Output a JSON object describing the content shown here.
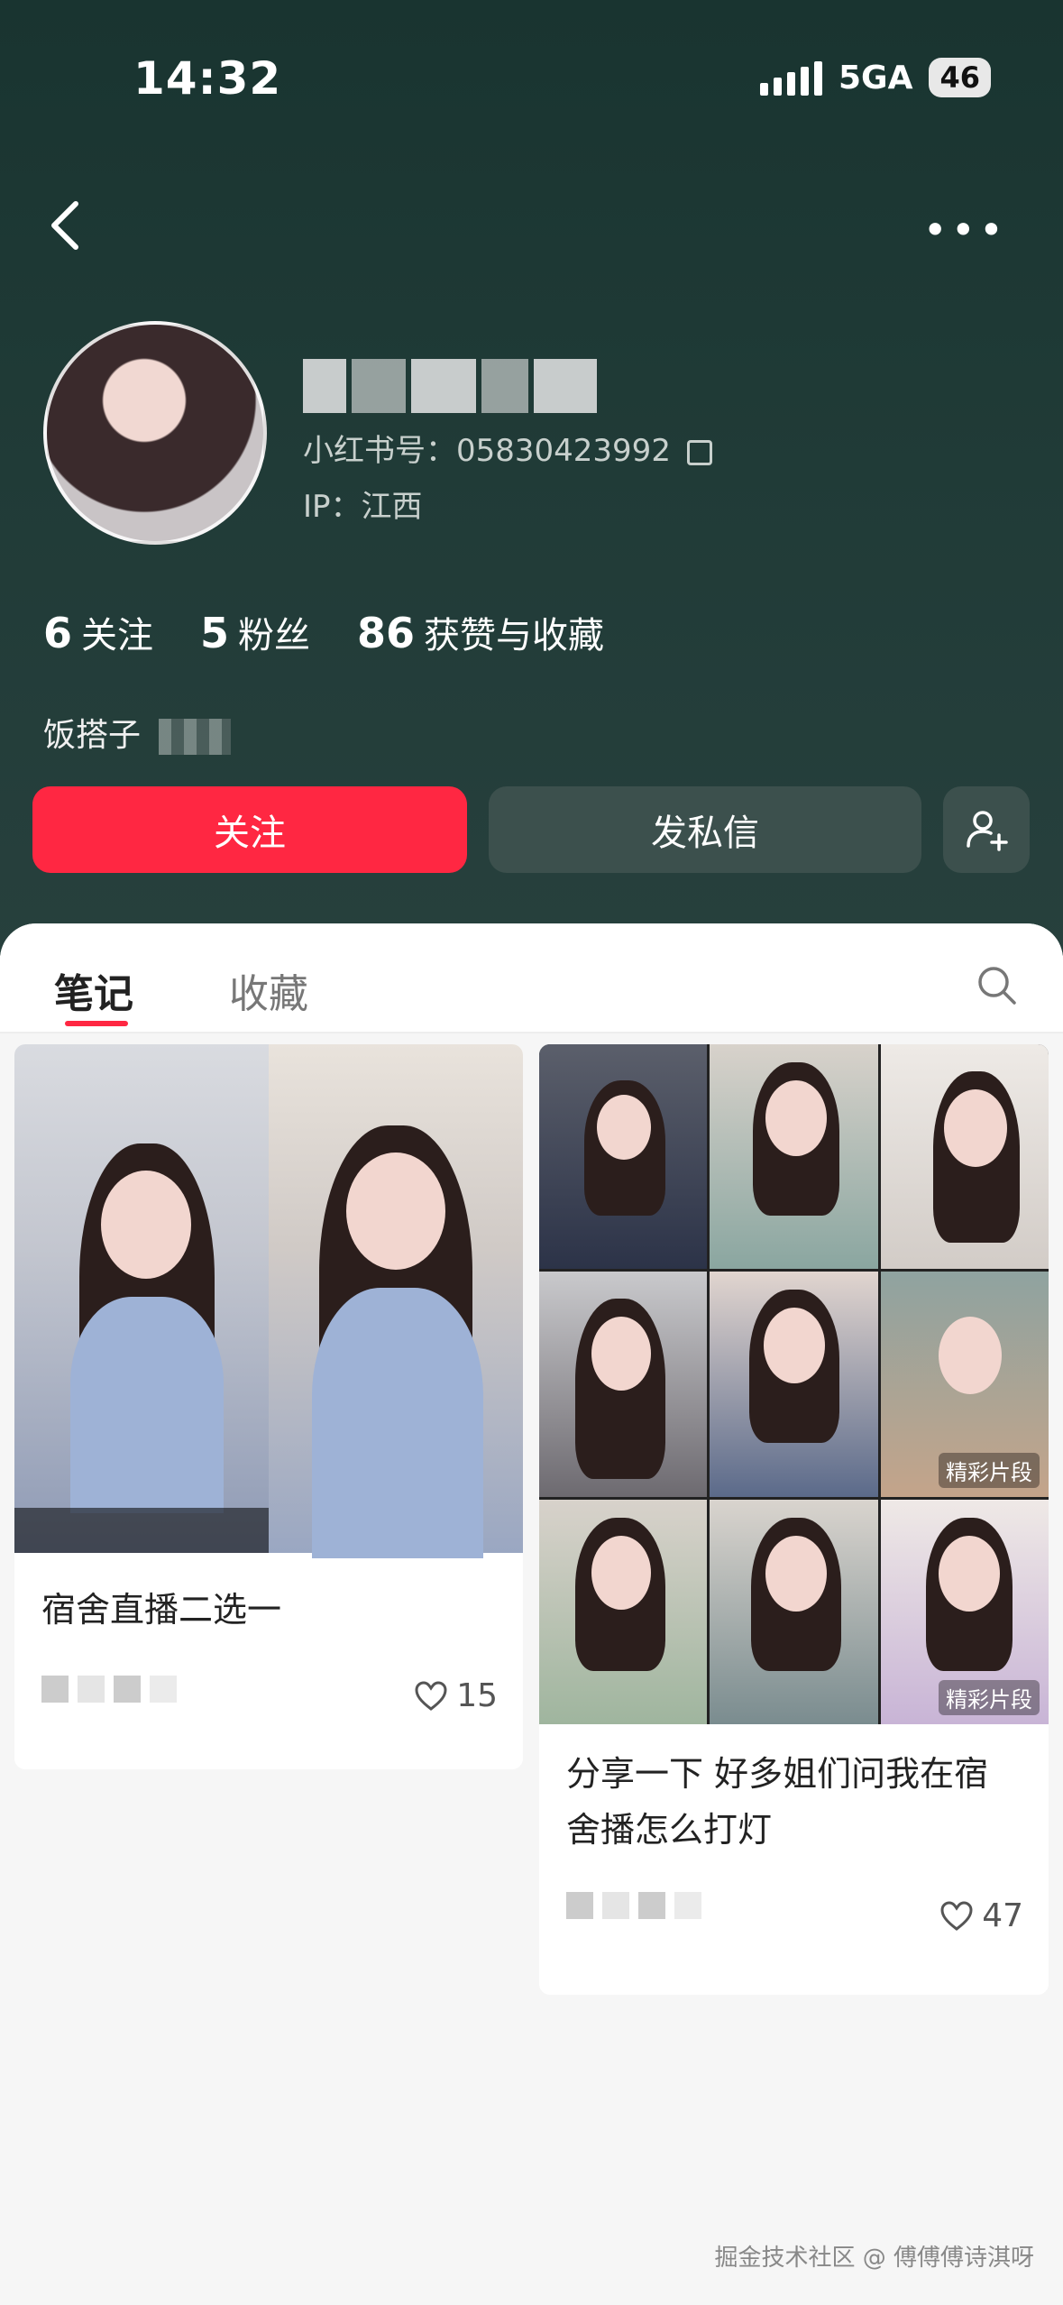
{
  "status": {
    "time": "14:32",
    "network": "5GA",
    "battery": "46"
  },
  "profile": {
    "redbook_id": "小红书号：05830423992",
    "ip": "IP：江西",
    "stats": [
      {
        "num": "6",
        "label": "关注"
      },
      {
        "num": "5",
        "label": "粉丝"
      },
      {
        "num": "86",
        "label": "获赞与收藏"
      }
    ],
    "bio": "饭搭子"
  },
  "actions": {
    "follow": "关注",
    "message": "发私信"
  },
  "tabs": {
    "notes": "笔记",
    "saved": "收藏"
  },
  "notes": [
    {
      "title": "宿舍直播二选一",
      "likes": "15"
    },
    {
      "title": "分享一下 好多姐们问我在宿舍播怎么打灯",
      "likes": "47",
      "tag": "精彩片段"
    }
  ],
  "watermark": "掘金技术社区 @ 傅傅傅诗淇呀",
  "colors": {
    "accent": "#ff2742",
    "header_bg": "#1f3a36"
  }
}
